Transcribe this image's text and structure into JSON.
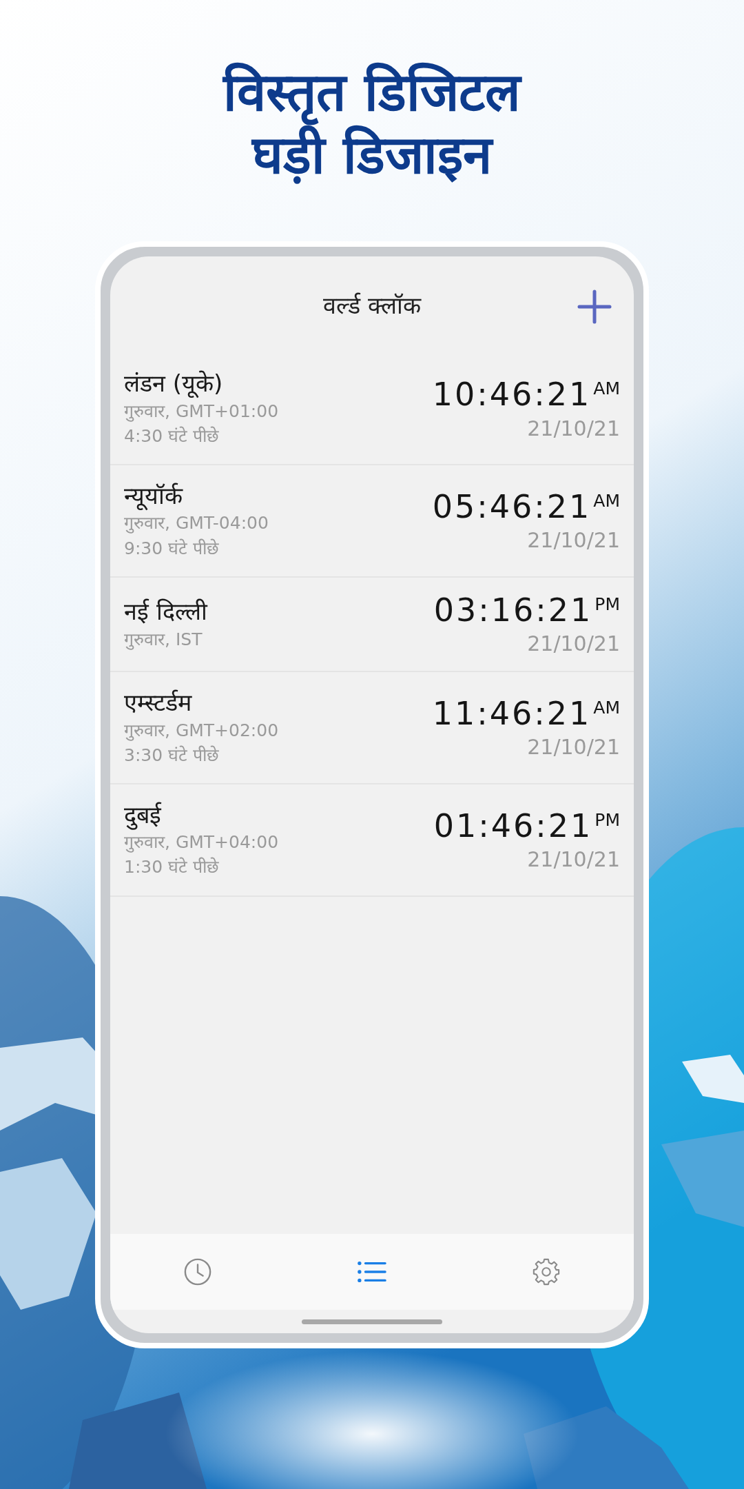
{
  "headline": [
    "विस्तृत डिजिटल",
    "घड़ी डिजाइन"
  ],
  "screen": {
    "title": "वर्ल्ड क्लॉक",
    "clocks": [
      {
        "city": "लंडन (यूके)",
        "zone": "गुरुवार, GMT+01:00",
        "offset": "4:30 घंटे पीछे",
        "time": "10:46:21",
        "period": "AM",
        "date": "21/10/21"
      },
      {
        "city": "न्यूयॉर्क",
        "zone": "गुरुवार, GMT-04:00",
        "offset": "9:30 घंटे पीछे",
        "time": "05:46:21",
        "period": "AM",
        "date": "21/10/21"
      },
      {
        "city": "नई दिल्ली",
        "zone": "गुरुवार, IST",
        "time": "03:16:21",
        "period": "PM",
        "date": "21/10/21"
      },
      {
        "city": "एम्स्टर्डम",
        "zone": "गुरुवार, GMT+02:00",
        "offset": "3:30 घंटे पीछे",
        "time": "11:46:21",
        "period": "AM",
        "date": "21/10/21"
      },
      {
        "city": "दुबई",
        "zone": "गुरुवार, GMT+04:00",
        "offset": "1:30 घंटे पीछे",
        "time": "01:46:21",
        "period": "PM",
        "date": "21/10/21"
      }
    ],
    "tabs": [
      {
        "kind": "clock",
        "selected": false
      },
      {
        "kind": "list",
        "selected": true
      },
      {
        "kind": "settings",
        "selected": false
      }
    ]
  }
}
